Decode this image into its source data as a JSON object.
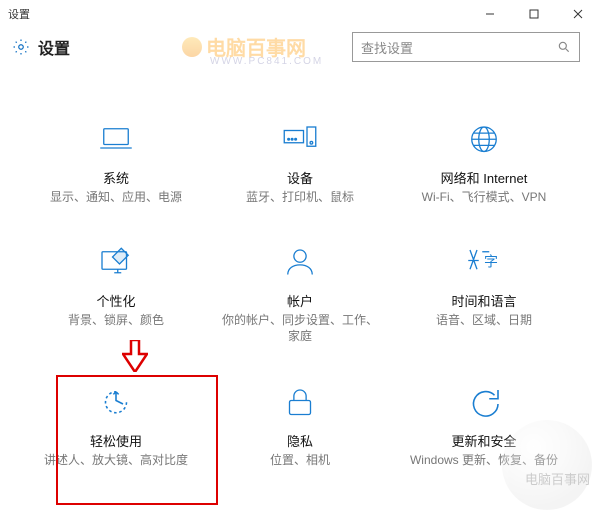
{
  "window": {
    "title": "设置"
  },
  "header": {
    "title": "设置"
  },
  "search": {
    "placeholder": "查找设置"
  },
  "tiles": [
    {
      "title": "系统",
      "desc": "显示、通知、应用、电源"
    },
    {
      "title": "设备",
      "desc": "蓝牙、打印机、鼠标"
    },
    {
      "title": "网络和 Internet",
      "desc": "Wi-Fi、飞行模式、VPN"
    },
    {
      "title": "个性化",
      "desc": "背景、锁屏、颜色"
    },
    {
      "title": "帐户",
      "desc": "你的帐户、同步设置、工作、家庭"
    },
    {
      "title": "时间和语言",
      "desc": "语音、区域、日期"
    },
    {
      "title": "轻松使用",
      "desc": "讲述人、放大镜、高对比度"
    },
    {
      "title": "隐私",
      "desc": "位置、相机"
    },
    {
      "title": "更新和安全",
      "desc": "Windows 更新、恢复、备份"
    }
  ],
  "watermark": {
    "text": "电脑百事网",
    "sub": "WWW.PC841.COM",
    "corner": "电脑百事网"
  }
}
